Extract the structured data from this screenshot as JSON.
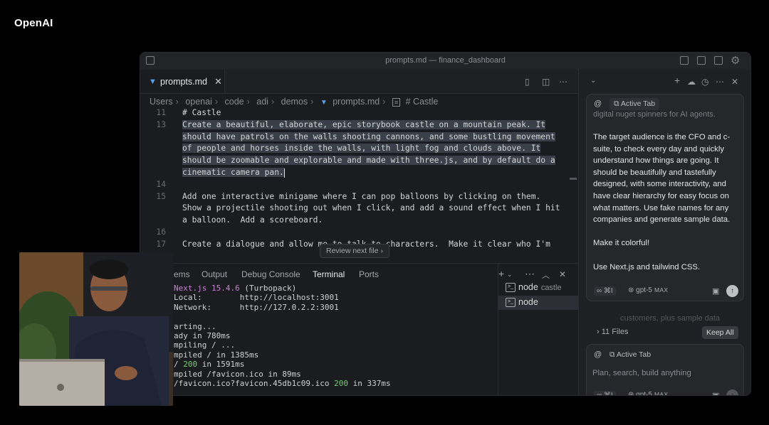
{
  "brand": "OpenAI",
  "window": {
    "title": "prompts.md — finance_dashboard"
  },
  "editor": {
    "tab_label": "prompts.md",
    "breadcrumbs": [
      "Users",
      "openai",
      "code",
      "adi",
      "demos",
      "prompts.md",
      "# Castle"
    ],
    "lines": [
      {
        "num": "11",
        "text": "# Castle",
        "selected": false
      },
      {
        "num": "13",
        "text": "Create a beautiful, elaborate, epic storybook castle on a mountain peak. It",
        "selected": true
      },
      {
        "num": "",
        "text": "should have patrols on the walls shooting cannons, and some bustling movement",
        "selected": true
      },
      {
        "num": "",
        "text": "of people and horses inside the walls, with light fog and clouds above. It",
        "selected": true
      },
      {
        "num": "",
        "text": "should be zoomable and explorable and made with three.js, and by default do a",
        "selected": true
      },
      {
        "num": "",
        "text": "cinematic camera pan.",
        "selected": true
      },
      {
        "num": "14",
        "text": "",
        "selected": false
      },
      {
        "num": "15",
        "text": "Add one interactive minigame where I can pop balloons by clicking on them.",
        "selected": false
      },
      {
        "num": "",
        "text": "Show a projectile shooting out when I click, and add a sound effect when I hit",
        "selected": false
      },
      {
        "num": "",
        "text": "a balloon.  Add a scoreboard.",
        "selected": false
      },
      {
        "num": "16",
        "text": "",
        "selected": false
      },
      {
        "num": "17",
        "text": "Create a dialogue and allow me to talk to characters.  Make it clear who I'm",
        "selected": false
      }
    ],
    "review_label": "Review next file"
  },
  "panel": {
    "tabs": [
      "ems",
      "Output",
      "Debug Console",
      "Terminal",
      "Ports"
    ],
    "active_tab": "Terminal",
    "terminal_lines": [
      {
        "a": "Next.js 15.4.6",
        "b": " (Turbopack)"
      },
      {
        "a": "Local:        ",
        "b": "http://localhost:3001"
      },
      {
        "a": "Network:      ",
        "b": "http://127.0.2.2:3001"
      },
      {
        "a": "",
        "b": ""
      },
      {
        "a": "arting...",
        "b": ""
      },
      {
        "a": "ady in 780ms",
        "b": ""
      },
      {
        "a": "mpiling / ...",
        "b": ""
      },
      {
        "a": "mpiled / in 1385ms",
        "b": ""
      },
      {
        "a": "/ ",
        "b": "200",
        "c": " in 1591ms"
      },
      {
        "a": "mpiled /favicon.ico in 89ms",
        "b": ""
      },
      {
        "a": "/favicon.ico?favicon.45db1c09.ico ",
        "b": "200",
        "c": " in 337ms"
      }
    ],
    "terminals": [
      {
        "name": "node",
        "sub": "castle"
      },
      {
        "name": "node",
        "sub": ""
      }
    ]
  },
  "chat": {
    "at_symbol": "@",
    "active_tab_chip": "Active Tab",
    "cut_line": "digital nuget spinners for AI agents.",
    "message": [
      "The target audience is the CFO and c-suite, to check every day and quickly understand how things are going. It should be beautifully and tastefully designed, with some interactivity, and have clear hierarchy for easy focus on what matters.  Use fake names for any companies and generate sample data.",
      "Make it colorful!",
      "Use Next.js and tailwind CSS."
    ],
    "shortcut": "∞ ⌘I",
    "model": "gpt-5",
    "model_badge": "MAX",
    "ghost_text": "customers, plus sample data",
    "files_label": "11 Files",
    "keep_all": "Keep All",
    "placeholder": "Plan, search, build anything"
  }
}
